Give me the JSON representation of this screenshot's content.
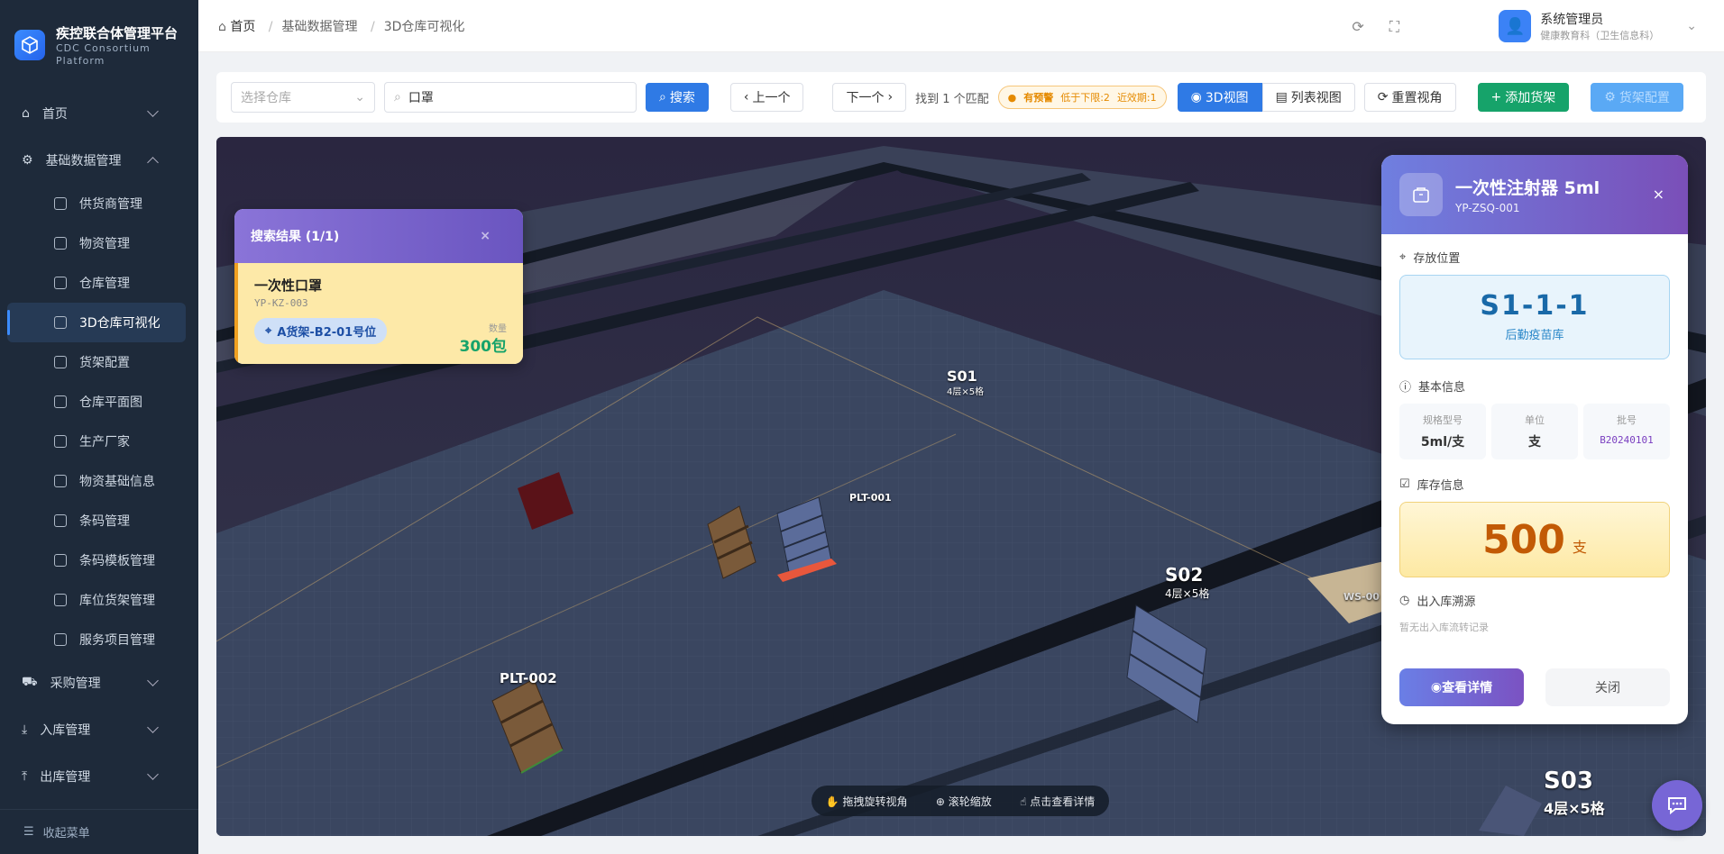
{
  "app": {
    "title": "疾控联合体管理平台",
    "subtitle_1": "CDC Consortium",
    "subtitle_2": "Platform"
  },
  "sidebar": {
    "items": [
      {
        "label": "首页"
      },
      {
        "label": "基础数据管理"
      },
      {
        "label": "采购管理"
      },
      {
        "label": "入库管理"
      },
      {
        "label": "出库管理"
      }
    ],
    "sub_items": [
      {
        "label": "供货商管理"
      },
      {
        "label": "物资管理"
      },
      {
        "label": "仓库管理"
      },
      {
        "label": "3D仓库可视化"
      },
      {
        "label": "货架配置"
      },
      {
        "label": "仓库平面图"
      },
      {
        "label": "生产厂家"
      },
      {
        "label": "物资基础信息"
      },
      {
        "label": "条码管理"
      },
      {
        "label": "条码模板管理"
      },
      {
        "label": "库位货架管理"
      },
      {
        "label": "服务项目管理"
      }
    ],
    "collapse_label": "收起菜单"
  },
  "breadcrumb": {
    "home": "首页",
    "level1": "基础数据管理",
    "level2": "3D仓库可视化"
  },
  "user": {
    "name": "系统管理员",
    "dept": "健康教育科（卫生信息科）"
  },
  "toolbar": {
    "warehouse_placeholder": "选择仓库",
    "search_value": "口罩",
    "search_label": "搜索",
    "prev_label": "上一个",
    "next_label": "下一个",
    "match_text": "找到 1 个匹配",
    "warn_label": "有预警",
    "warn_low": "低于下限:2",
    "warn_expiry": "近效期:1",
    "view3d_label": "3D视图",
    "list_label": "列表视图",
    "reset_label": "重置视角",
    "add_shelf_label": "添加货架",
    "shelf_config_label": "货架配置"
  },
  "scene": {
    "labels": {
      "s01": "S01",
      "s01_sub": "4层×5格",
      "s02": "S02",
      "s02_sub": "4层×5格",
      "s03": "S03",
      "s03_sub": "4层×5格",
      "plt001": "PLT-001",
      "plt002": "PLT-002",
      "ws": "WS-00"
    },
    "hints": {
      "drag": "拖拽旋转视角",
      "zoom": "滚轮缩放",
      "click": "点击查看详情"
    }
  },
  "results": {
    "title": "搜索结果 (1/1)",
    "item": {
      "name": "一次性口罩",
      "code": "YP-KZ-003",
      "location": "A货架-B2-01号位",
      "qty_label": "数量",
      "qty": "300包"
    }
  },
  "detail": {
    "name": "一次性注射器 5ml",
    "code": "YP-ZSQ-001",
    "loc_section": "存放位置",
    "loc_code": "S1-1-1",
    "loc_wh": "后勤疫苗库",
    "info_section": "基本信息",
    "info": [
      {
        "k": "规格型号",
        "v": "5ml/支"
      },
      {
        "k": "单位",
        "v": "支"
      },
      {
        "k": "批号",
        "v": "B20240101"
      }
    ],
    "stock_section": "库存信息",
    "stock": "500",
    "stock_unit": "支",
    "trace_section": "出入库溯源",
    "trace_empty": "暂无出入库流转记录",
    "view_label": "查看详情",
    "close_label": "关闭"
  },
  "colors": {
    "sidebar": "#1e2a3a",
    "accent": "#2f7ae5",
    "green": "#16a36a",
    "purple": "#7a4fb8"
  }
}
